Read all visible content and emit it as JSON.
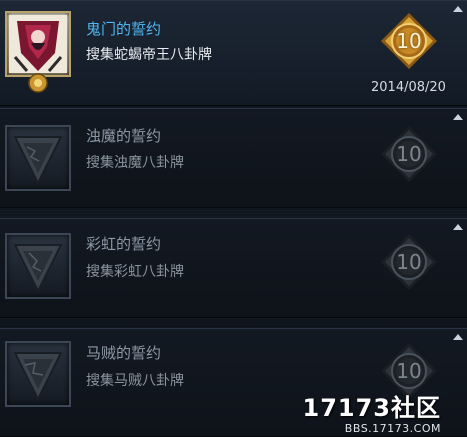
{
  "pledges": [
    {
      "title": "鬼门的誓约",
      "description": "搜集蛇蝎帝王八卦牌",
      "level": "10",
      "date": "2014/08/20",
      "state": "completed",
      "icon": "trump-card-portrait-icon"
    },
    {
      "title": "浊魔的誓约",
      "description": "搜集浊魔八卦牌",
      "level": "10",
      "date": "",
      "state": "locked",
      "icon": "bagua-fragment-icon"
    },
    {
      "title": "彩虹的誓约",
      "description": "搜集彩虹八卦牌",
      "level": "10",
      "date": "",
      "state": "locked",
      "icon": "bagua-fragment-icon"
    },
    {
      "title": "马贼的誓约",
      "description": "搜集马贼八卦牌",
      "level": "10",
      "date": "",
      "state": "locked",
      "icon": "bagua-fragment-icon"
    }
  ],
  "watermark": {
    "logo": "17173社区",
    "url": "BBS.17173.COM"
  },
  "colors": {
    "active_title": "#4fb6ef",
    "gold_badge": "#c8922a",
    "locked_badge": "#2a2f36"
  }
}
